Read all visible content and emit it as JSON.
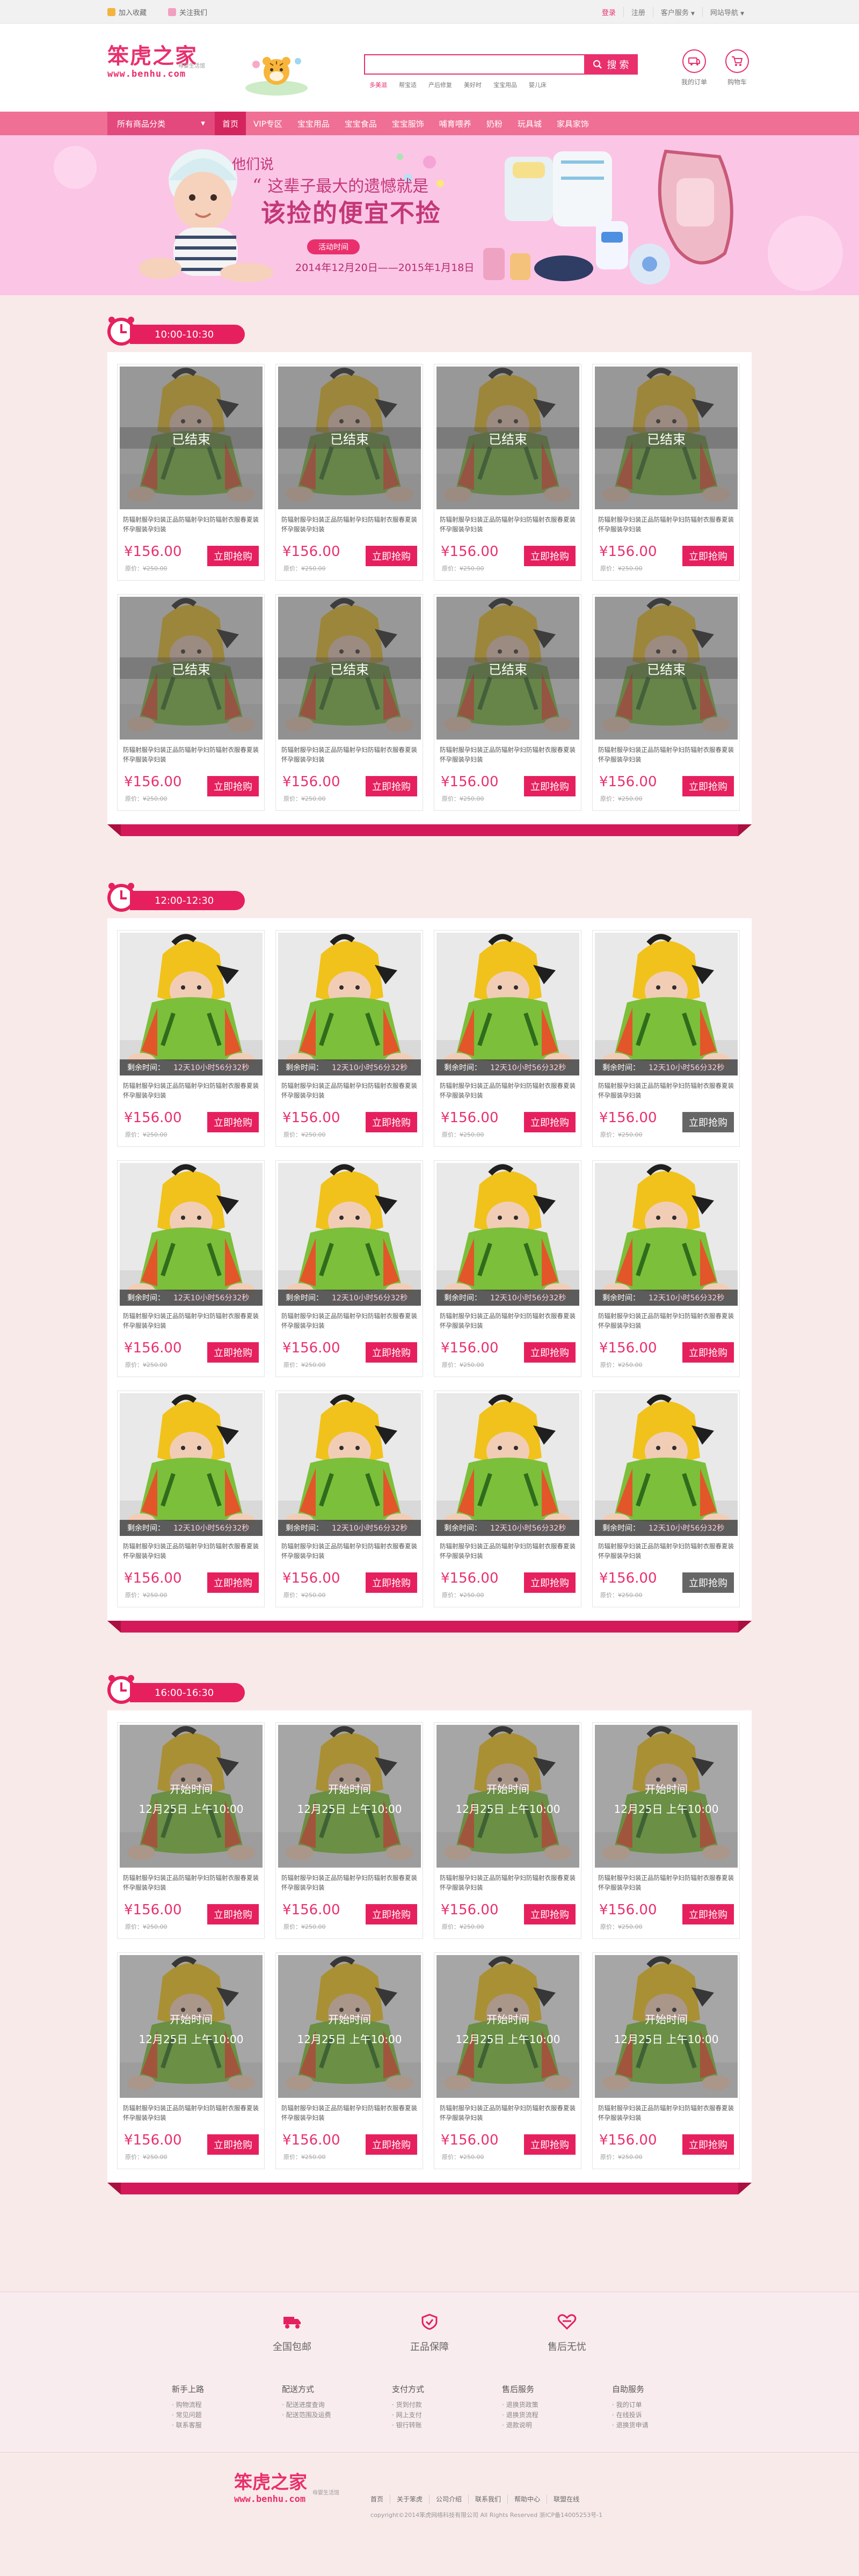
{
  "topbar": {
    "favorite": "加入收藏",
    "follow": "关注我们",
    "login": "登录",
    "register": "注册",
    "service": "客户服务",
    "sitemap": "网站导航"
  },
  "header": {
    "logo_main": "笨虎之家",
    "logo_sub": "母婴生活馆",
    "logo_url": "www.benhu.com",
    "search_button": "搜 索",
    "hot_words": [
      "多美滋",
      "帮宝适",
      "产后修复",
      "美好时",
      "宝宝用品",
      "婴儿床"
    ],
    "my_orders": "我的订单",
    "cart": "购物车"
  },
  "nav": {
    "category": "所有商品分类",
    "items": [
      "首页",
      "VIP专区",
      "宝宝用品",
      "宝宝食品",
      "宝宝服饰",
      "哺育喂养",
      "奶粉",
      "玩具城",
      "家具家饰"
    ]
  },
  "banner": {
    "say": "他们说",
    "line1": "这辈子最大的遗憾就是",
    "line2": "该捡的便宜不捡",
    "tag": "活动时间",
    "date": "2014年12月20日——2015年1月18日"
  },
  "product": {
    "title": "防辐射服孕妇装正品防辐射孕妇防辐射衣服春夏装怀孕服装孕妇装",
    "price": "¥156.00",
    "orig_label": "原价：",
    "orig_price": "¥250.00",
    "buy": "立即抢购"
  },
  "status": {
    "ended": "已结束",
    "remaining_label": "剩余时间：",
    "remaining": "12天10小时56分32秒",
    "start_label": "开始时间",
    "start_time": "12月25日  上午10:00"
  },
  "sections": [
    {
      "time": "10:00-10:30"
    },
    {
      "time": "12:00-12:30"
    },
    {
      "time": "16:00-16:30"
    }
  ],
  "footer": {
    "services": [
      "全国包邮",
      "正品保障",
      "售后无忧"
    ],
    "columns": [
      {
        "title": "新手上路",
        "items": [
          "· 购物流程",
          "· 常见问题",
          "· 联系客服"
        ]
      },
      {
        "title": "配送方式",
        "items": [
          "· 配送进度查询",
          "· 配送范围及运费"
        ]
      },
      {
        "title": "支付方式",
        "items": [
          "· 货到付款",
          "· 网上支付",
          "· 银行转账"
        ]
      },
      {
        "title": "售后服务",
        "items": [
          "· 退换货政策",
          "· 退换货流程",
          "· 退款说明"
        ]
      },
      {
        "title": "自助服务",
        "items": [
          "· 我的订单",
          "· 在线投诉",
          "· 退换货申请"
        ]
      }
    ],
    "links": [
      "首页",
      "关于笨虎",
      "公司介绍",
      "联系我们",
      "帮助中心",
      "联盟在线"
    ],
    "copyright": "copyright©2014笨虎网络科技有限公司 All Rights Reserved    浙ICP备14005253号-1"
  }
}
